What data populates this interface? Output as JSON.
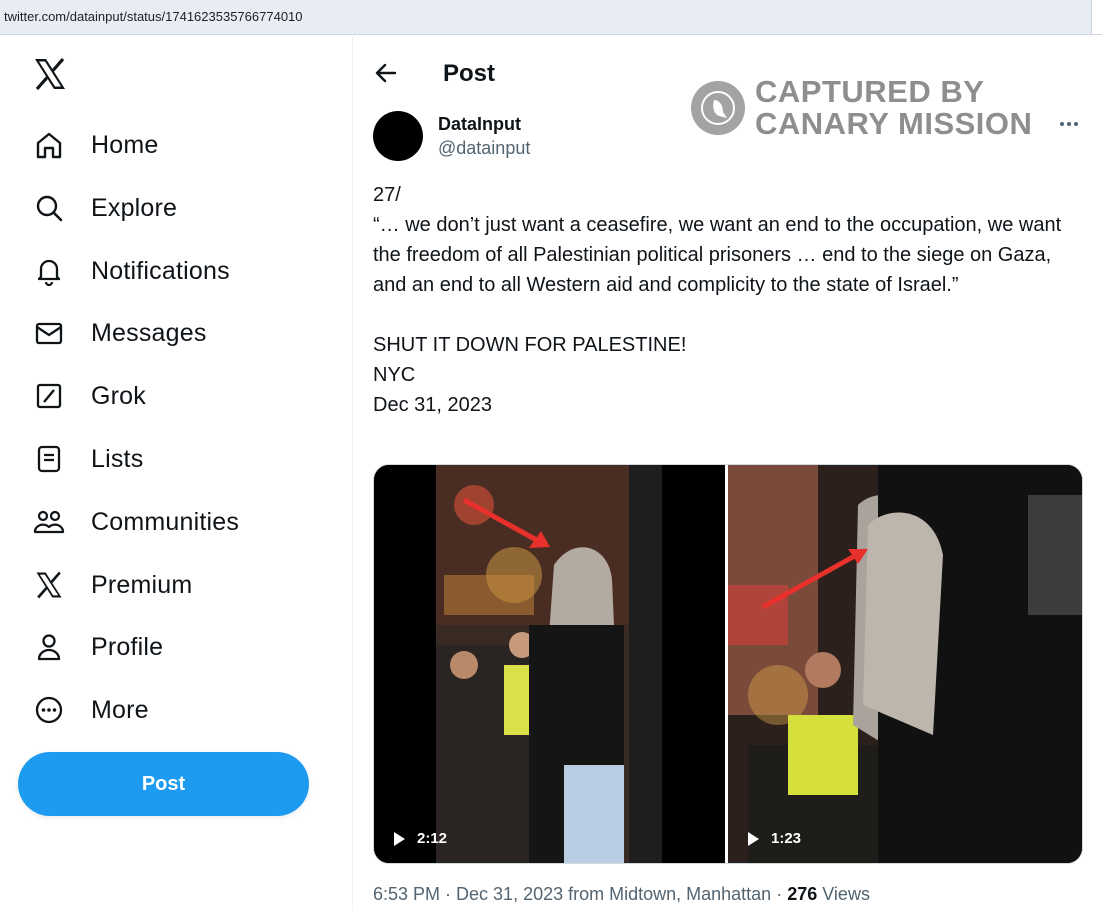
{
  "browser": {
    "url": "twitter.com/datainput/status/1741623535766774010"
  },
  "sidebar": {
    "items": [
      {
        "label": "Home",
        "icon": "home-icon"
      },
      {
        "label": "Explore",
        "icon": "search-icon"
      },
      {
        "label": "Notifications",
        "icon": "bell-icon"
      },
      {
        "label": "Messages",
        "icon": "envelope-icon"
      },
      {
        "label": "Grok",
        "icon": "grok-icon"
      },
      {
        "label": "Lists",
        "icon": "list-icon"
      },
      {
        "label": "Communities",
        "icon": "communities-icon"
      },
      {
        "label": "Premium",
        "icon": "x-logo-icon"
      },
      {
        "label": "Profile",
        "icon": "person-icon"
      },
      {
        "label": "More",
        "icon": "more-circle-icon"
      }
    ],
    "post_button": "Post"
  },
  "header": {
    "title": "Post"
  },
  "watermark": {
    "line1": "CAPTURED BY",
    "line2": "CANARY MISSION"
  },
  "tweet": {
    "author_name": "DataInput",
    "author_handle": "@datainput",
    "text": "27/\n“… we don’t just want a ceasefire, we want an end to the occupation, we want the freedom of all Palestinian political prisoners … end to the siege on Gaza, and an end to all Western aid and complicity to the state of Israel.”\n\nSHUT IT DOWN FOR PALESTINE!\nNYC\nDec 31, 2023",
    "videos": [
      {
        "duration": "2:12"
      },
      {
        "duration": "1:23"
      }
    ],
    "meta_prefix": "6:53 PM · Dec 31, 2023 from Midtown, Manhattan · ",
    "views_count": "276",
    "views_label": " Views"
  },
  "colors": {
    "accent": "#1d9bf0",
    "text": "#0f1419",
    "muted": "#536471"
  }
}
